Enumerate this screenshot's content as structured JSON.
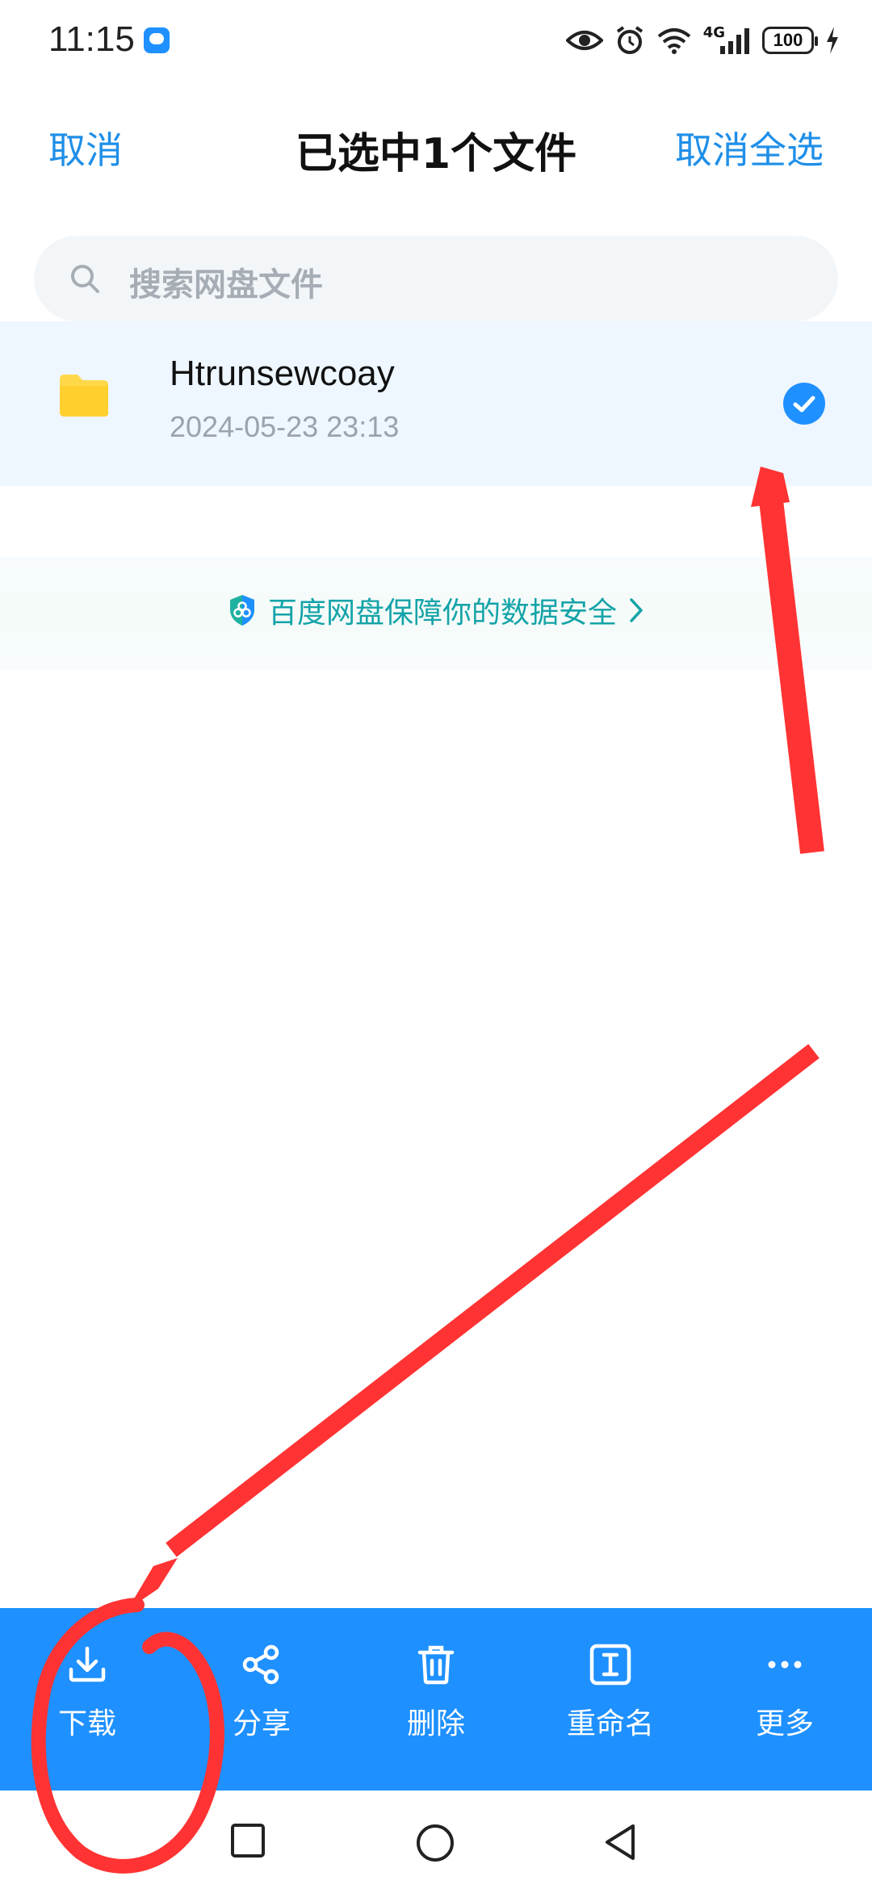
{
  "status_bar": {
    "time": "11:15",
    "network_label": "4G",
    "battery": "100"
  },
  "header": {
    "cancel": "取消",
    "title": "已选中1个文件",
    "deselect_all": "取消全选"
  },
  "search": {
    "placeholder": "搜索网盘文件"
  },
  "file": {
    "name": "Htrunsewcoay",
    "date": "2024-05-23  23:13",
    "selected": true
  },
  "security_banner": {
    "text": "百度网盘保障你的数据安全"
  },
  "toolbar": {
    "items": [
      {
        "label": "下载",
        "icon": "download-icon"
      },
      {
        "label": "分享",
        "icon": "share-icon"
      },
      {
        "label": "删除",
        "icon": "trash-icon"
      },
      {
        "label": "重命名",
        "icon": "rename-icon"
      },
      {
        "label": "更多",
        "icon": "more-icon"
      }
    ]
  },
  "colors": {
    "accent": "#1e90ff",
    "link": "#1f8fe8",
    "secure": "#14a3a8",
    "annotation": "#ff3333"
  }
}
